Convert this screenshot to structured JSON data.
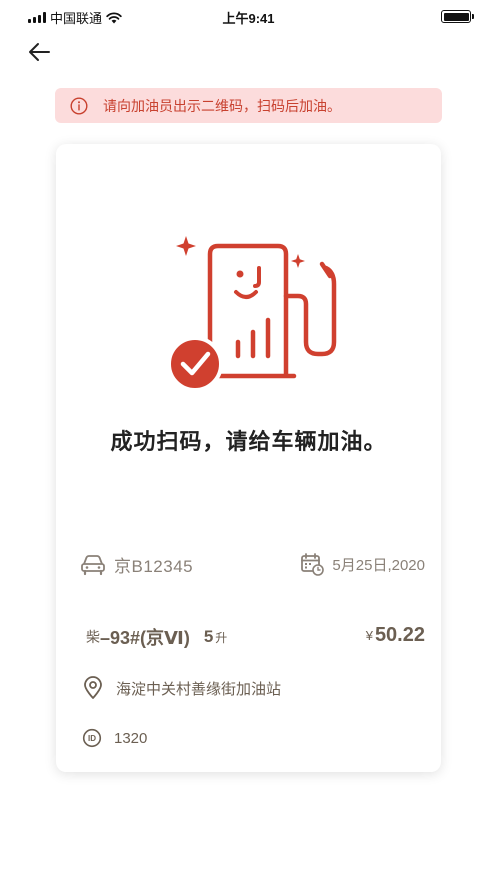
{
  "status_bar": {
    "carrier": "中国联通",
    "time": "上午9:41"
  },
  "nav": {
    "back_icon": "arrow-left-icon"
  },
  "alert": {
    "icon": "info-circle-icon",
    "text": "请向加油员出示二维码，扫码后加油。"
  },
  "card": {
    "illustration": "fuel-pump-success-illustration",
    "title": "成功扫码，请给车辆加油。",
    "plate": {
      "icon": "car-icon",
      "value": "京B12345"
    },
    "date": {
      "icon": "calendar-icon",
      "value": "5月25日,2020"
    },
    "fuel": {
      "kind": "柴",
      "grade": "–93#(京Ⅵ)",
      "quantity": "5",
      "unit": "升"
    },
    "price": {
      "currency": "¥",
      "value": "50.22"
    },
    "station": {
      "icon": "location-pin-icon",
      "value": "海淀中关村善缘街加油站"
    },
    "id": {
      "icon": "id-badge-icon",
      "value": "1320"
    }
  },
  "colors": {
    "accent_red": "#d0402f",
    "alert_bg": "#fcdcdc",
    "text_brown": "#6b5f52",
    "text_muted": "#8a8178"
  }
}
